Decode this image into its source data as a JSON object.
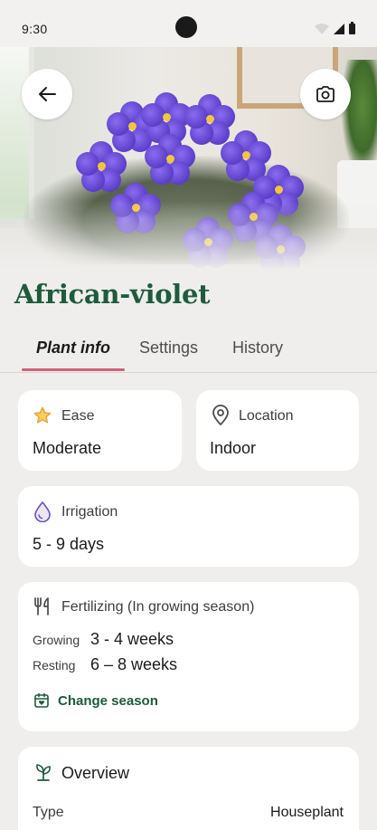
{
  "status_bar": {
    "time": "9:30"
  },
  "plant": {
    "name": "African-violet"
  },
  "tabs": [
    {
      "label": "Plant info",
      "active": true
    },
    {
      "label": "Settings",
      "active": false
    },
    {
      "label": "History",
      "active": false
    }
  ],
  "ease": {
    "label": "Ease",
    "value": "Moderate",
    "icon": "star-icon"
  },
  "location": {
    "label": "Location",
    "value": "Indoor",
    "icon": "location-pin-icon"
  },
  "irrigation": {
    "label": "Irrigation",
    "value": "5 - 9 days",
    "icon": "water-drop-icon"
  },
  "fertilizing": {
    "label": "Fertilizing (In growing season)",
    "icon": "fork-knife-icon",
    "growing_label": "Growing",
    "growing_value": "3 - 4 weeks",
    "resting_label": "Resting",
    "resting_value": "6 – 8 weeks",
    "change_season_label": "Change season",
    "change_season_icon": "calendar-heart-icon"
  },
  "overview": {
    "title": "Overview",
    "icon": "sprout-icon",
    "type_label": "Type",
    "type_value": "Houseplant"
  },
  "colors": {
    "accent_green": "#1d5b3c",
    "tab_indicator": "#d0607a",
    "star": "#e8a33b",
    "drop": "#6a4fb8"
  }
}
